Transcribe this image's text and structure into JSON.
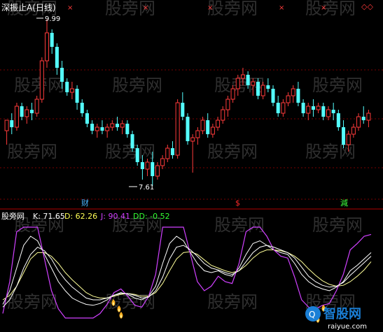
{
  "watermark_text": "股旁网",
  "upper_panel": {
    "title": "深振止A(日线)",
    "max_price_label": "9.99",
    "min_price_label": "7.61",
    "signal_labels": [
      {
        "text": "财",
        "color": "#4ab4ff"
      },
      {
        "text": "$",
        "color": "#ff2a2a"
      },
      {
        "text": "減",
        "color": "#3cff3c"
      }
    ],
    "colors": {
      "up": "#ff3b3b",
      "down": "#54ffff",
      "bg": "#000000",
      "grid": "#7a0000",
      "separator": "#b00000"
    }
  },
  "lower_panel": {
    "indicator_name": "股旁网",
    "readouts": [
      {
        "label": "K: 71.65",
        "color": "#ffffff"
      },
      {
        "label": "D: 62.26",
        "color": "#ffff55"
      },
      {
        "label": "J: 90.41",
        "color": "#d040ff"
      },
      {
        "label": "DD: -0.52",
        "color": "#33ff33"
      }
    ],
    "line_colors": {
      "K": "#ffffff",
      "D": "#ffff99",
      "J": "#d040ff",
      "extra": "#ffffff"
    }
  },
  "logo": {
    "name": "智股网",
    "domain": "raiyue.com",
    "color": "#1a7fd6"
  },
  "chart_data": [
    {
      "type": "candlestick",
      "title": "深振止A(日线)",
      "annotations": [
        "9.99",
        "7.61"
      ],
      "series": [
        {
          "values": [
            [
              8.4,
              8.55,
              8.2,
              8.55
            ],
            [
              8.55,
              8.65,
              8.35,
              8.45
            ],
            [
              8.45,
              8.8,
              8.4,
              8.75
            ],
            [
              8.75,
              8.8,
              8.55,
              8.6
            ],
            [
              8.6,
              8.75,
              8.5,
              8.7
            ],
            [
              8.7,
              8.8,
              8.55,
              8.65
            ],
            [
              8.65,
              8.9,
              8.6,
              8.85
            ],
            [
              8.85,
              9.45,
              8.8,
              9.4
            ],
            [
              9.4,
              9.99,
              9.3,
              9.8
            ],
            [
              9.8,
              9.85,
              9.5,
              9.6
            ],
            [
              9.6,
              9.65,
              9.2,
              9.3
            ],
            [
              9.3,
              9.4,
              9.0,
              9.1
            ],
            [
              9.1,
              9.15,
              8.9,
              8.95
            ],
            [
              8.95,
              9.1,
              8.85,
              9.0
            ],
            [
              9.0,
              9.05,
              8.7,
              8.8
            ],
            [
              8.8,
              8.85,
              8.6,
              8.65
            ],
            [
              8.65,
              8.7,
              8.45,
              8.5
            ],
            [
              8.5,
              8.55,
              8.35,
              8.4
            ],
            [
              8.4,
              8.5,
              8.3,
              8.45
            ],
            [
              8.45,
              8.55,
              8.35,
              8.4
            ],
            [
              8.4,
              8.5,
              8.3,
              8.45
            ],
            [
              8.45,
              8.55,
              8.4,
              8.5
            ],
            [
              8.5,
              8.6,
              8.4,
              8.45
            ],
            [
              8.45,
              8.55,
              8.35,
              8.5
            ],
            [
              8.5,
              8.55,
              8.3,
              8.35
            ],
            [
              8.35,
              8.4,
              8.1,
              8.15
            ],
            [
              8.15,
              8.2,
              7.9,
              7.95
            ],
            [
              7.95,
              8.05,
              7.7,
              7.85
            ],
            [
              7.85,
              8.0,
              7.75,
              7.95
            ],
            [
              7.95,
              8.1,
              7.61,
              7.75
            ],
            [
              7.75,
              7.95,
              7.7,
              7.9
            ],
            [
              7.9,
              8.05,
              7.85,
              8.0
            ],
            [
              8.0,
              8.2,
              7.95,
              8.15
            ],
            [
              8.15,
              8.25,
              8.0,
              8.05
            ],
            [
              8.05,
              8.85,
              8.0,
              8.8
            ],
            [
              8.8,
              8.95,
              8.55,
              8.6
            ],
            [
              8.6,
              8.65,
              8.2,
              8.25
            ],
            [
              8.25,
              8.35,
              7.8,
              8.3
            ],
            [
              8.3,
              8.45,
              8.2,
              8.4
            ],
            [
              8.4,
              8.6,
              8.35,
              8.55
            ],
            [
              8.55,
              8.65,
              8.3,
              8.35
            ],
            [
              8.35,
              8.5,
              8.3,
              8.45
            ],
            [
              8.45,
              8.6,
              8.4,
              8.55
            ],
            [
              8.55,
              8.75,
              8.5,
              8.7
            ],
            [
              8.7,
              8.9,
              8.6,
              8.85
            ],
            [
              8.85,
              9.05,
              8.8,
              9.0
            ],
            [
              9.0,
              9.2,
              8.9,
              9.15
            ],
            [
              9.15,
              9.3,
              9.05,
              9.2
            ],
            [
              9.2,
              9.25,
              9.0,
              9.05
            ],
            [
              9.05,
              9.15,
              8.9,
              9.1
            ],
            [
              9.1,
              9.15,
              8.85,
              8.9
            ],
            [
              8.9,
              9.1,
              8.85,
              9.05
            ],
            [
              9.05,
              9.15,
              8.95,
              9.0
            ],
            [
              9.0,
              9.05,
              8.75,
              8.8
            ],
            [
              8.8,
              8.9,
              8.6,
              8.65
            ],
            [
              8.65,
              8.85,
              8.6,
              8.8
            ],
            [
              8.8,
              8.95,
              8.75,
              8.9
            ],
            [
              8.9,
              9.05,
              8.8,
              9.0
            ],
            [
              9.0,
              9.1,
              8.75,
              8.8
            ],
            [
              8.8,
              8.85,
              8.6,
              8.65
            ],
            [
              8.65,
              8.8,
              8.55,
              8.75
            ],
            [
              8.75,
              8.85,
              8.6,
              8.7
            ],
            [
              8.7,
              8.8,
              8.65,
              8.75
            ],
            [
              8.75,
              8.8,
              8.55,
              8.6
            ],
            [
              8.6,
              8.75,
              8.55,
              8.7
            ],
            [
              8.7,
              8.8,
              8.55,
              8.65
            ],
            [
              8.65,
              8.7,
              8.4,
              8.45
            ],
            [
              8.45,
              8.55,
              8.15,
              8.2
            ],
            [
              8.2,
              8.4,
              8.1,
              8.35
            ],
            [
              8.35,
              8.5,
              8.3,
              8.45
            ],
            [
              8.45,
              8.65,
              8.4,
              8.6
            ],
            [
              8.6,
              8.75,
              8.5,
              8.55
            ],
            [
              8.55,
              8.7,
              8.45,
              8.65
            ]
          ]
        }
      ]
    },
    {
      "type": "line",
      "series": [
        {
          "name": "K",
          "values": [
            15,
            30,
            55,
            80,
            90,
            85,
            70,
            55,
            40,
            30,
            22,
            18,
            15,
            14,
            16,
            20,
            25,
            28,
            26,
            22,
            20,
            24,
            35,
            60,
            82,
            90,
            85,
            72,
            60,
            52,
            50,
            52,
            48,
            46,
            55,
            70,
            82,
            85,
            80,
            75,
            72,
            70,
            60,
            48,
            40,
            35,
            32,
            30,
            34,
            40,
            52,
            58,
            65,
            72
          ]
        },
        {
          "name": "D",
          "values": [
            20,
            25,
            35,
            50,
            65,
            72,
            72,
            68,
            60,
            50,
            42,
            35,
            28,
            24,
            22,
            22,
            24,
            26,
            27,
            26,
            24,
            24,
            28,
            38,
            52,
            65,
            72,
            73,
            70,
            64,
            58,
            55,
            52,
            50,
            52,
            58,
            66,
            72,
            75,
            75,
            74,
            72,
            68,
            62,
            54,
            47,
            41,
            37,
            35,
            36,
            40,
            46,
            53,
            62
          ]
        },
        {
          "name": "J",
          "values": [
            5,
            40,
            95,
            100,
            100,
            100,
            65,
            30,
            10,
            0,
            0,
            0,
            0,
            0,
            5,
            15,
            28,
            32,
            24,
            14,
            12,
            24,
            48,
            100,
            100,
            100,
            100,
            70,
            40,
            30,
            35,
            46,
            40,
            38,
            60,
            95,
            100,
            100,
            90,
            75,
            68,
            66,
            45,
            20,
            12,
            10,
            14,
            16,
            30,
            48,
            75,
            82,
            90,
            92
          ]
        },
        {
          "name": "extra",
          "values": [
            12,
            20,
            35,
            55,
            70,
            78,
            74,
            65,
            52,
            42,
            34,
            28,
            22,
            20,
            20,
            22,
            25,
            27,
            27,
            25,
            22,
            23,
            30,
            45,
            65,
            78,
            80,
            75,
            68,
            60,
            55,
            53,
            50,
            48,
            52,
            62,
            72,
            78,
            80,
            78,
            75,
            72,
            66,
            56,
            46,
            40,
            36,
            34,
            35,
            39,
            47,
            54,
            61,
            68
          ]
        }
      ]
    }
  ]
}
